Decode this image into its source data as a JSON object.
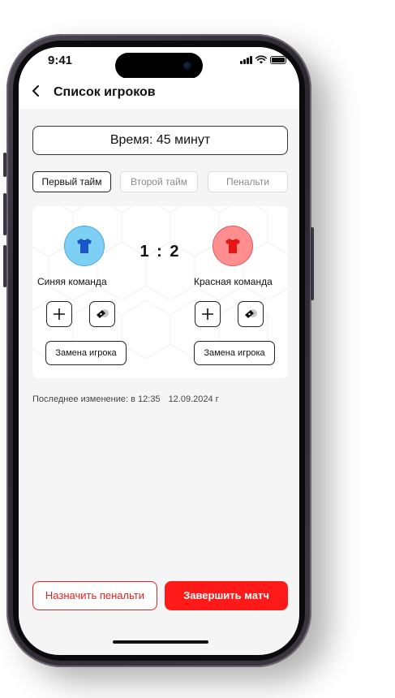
{
  "status_bar": {
    "time": "9:41"
  },
  "header": {
    "back_icon": "chevron-left-icon",
    "title": "Список игроков"
  },
  "timer": {
    "label": "Время: 45 минут"
  },
  "tabs": [
    {
      "label": "Первый тайм",
      "active": true
    },
    {
      "label": "Второй тайм",
      "active": false
    },
    {
      "label": "Пенальти",
      "active": false
    }
  ],
  "match": {
    "score": "1 : 2",
    "home_team": {
      "name": "Синяя команда",
      "color": "#7ecff4",
      "jersey_color": "#1a56c9",
      "icon": "jersey-icon"
    },
    "away_team": {
      "name": "Красная команда",
      "color": "#ff8f8f",
      "jersey_color": "#e81515",
      "icon": "jersey-icon"
    },
    "add_icon": "plus-icon",
    "whistle_icon": "whistle-icon",
    "substitution_label": "Замена игрока"
  },
  "last_change": {
    "label": "Последнее изменение:",
    "time": "в 12:35",
    "date": "12.09.2024 г"
  },
  "actions": {
    "penalty_label": "Назначить пенальти",
    "finish_label": "Завершить матч"
  },
  "colors": {
    "accent_red": "#ff1a1a",
    "background": "#f5f5f5"
  }
}
